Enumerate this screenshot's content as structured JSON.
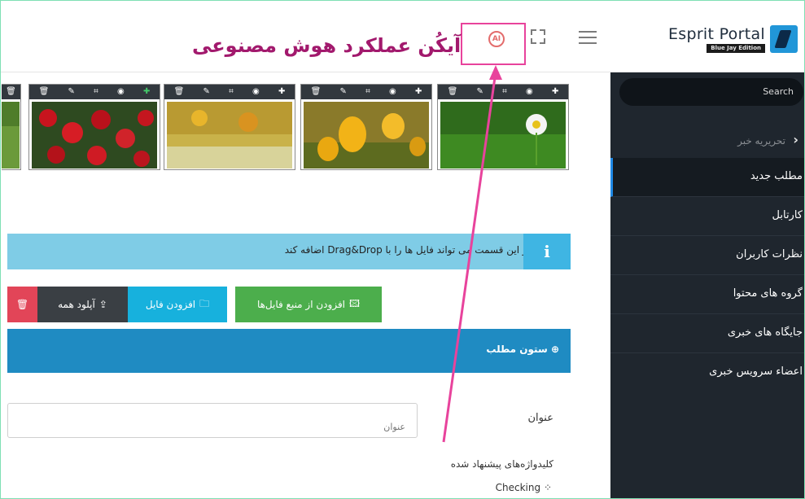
{
  "header": {
    "brand_name": "Esprit Portal",
    "brand_edition": "Blue Jay Edition",
    "annotation": "آیکُن عملکرد هوش مصنوعی",
    "ai_icon_label": "AI"
  },
  "sidebar": {
    "search": "Search",
    "group_label": "تحریریه خبر",
    "items": [
      {
        "label": "مطلب جدید"
      },
      {
        "label": "کارتابل"
      },
      {
        "label": "نظرات کاربران"
      },
      {
        "label": "گروه های محتوا"
      },
      {
        "label": "جایگاه های خبری"
      },
      {
        "label": "اعضاء سرویس خبری"
      }
    ]
  },
  "thumbnails": [
    {
      "name": "daisy"
    },
    {
      "name": "yellow tulips"
    },
    {
      "name": "golden meadow"
    },
    {
      "name": "red roses"
    },
    {
      "name": "green field"
    }
  ],
  "info": {
    "text": "در این قسمت می تواند فایل ها را با Drag&Drop اضافه کند"
  },
  "buttons": {
    "add_from_source": "افزودن از منبع فایل‌ها",
    "add_file": "افزودن فایل",
    "upload_all": "آپلود همه"
  },
  "panel": {
    "title": "ستون مطلب"
  },
  "form": {
    "title_label": "عنوان",
    "title_placeholder": "عنوان",
    "keywords_label": "کلیدواژه‌های پیشنهاد شده",
    "checking": "Checking"
  },
  "colors": {
    "annotation": "#a2196d",
    "highlight": "#e8439c",
    "sidebar_bg": "#1f262e",
    "info_bg": "#7fcce6",
    "panel_head": "#1f8bc2"
  }
}
